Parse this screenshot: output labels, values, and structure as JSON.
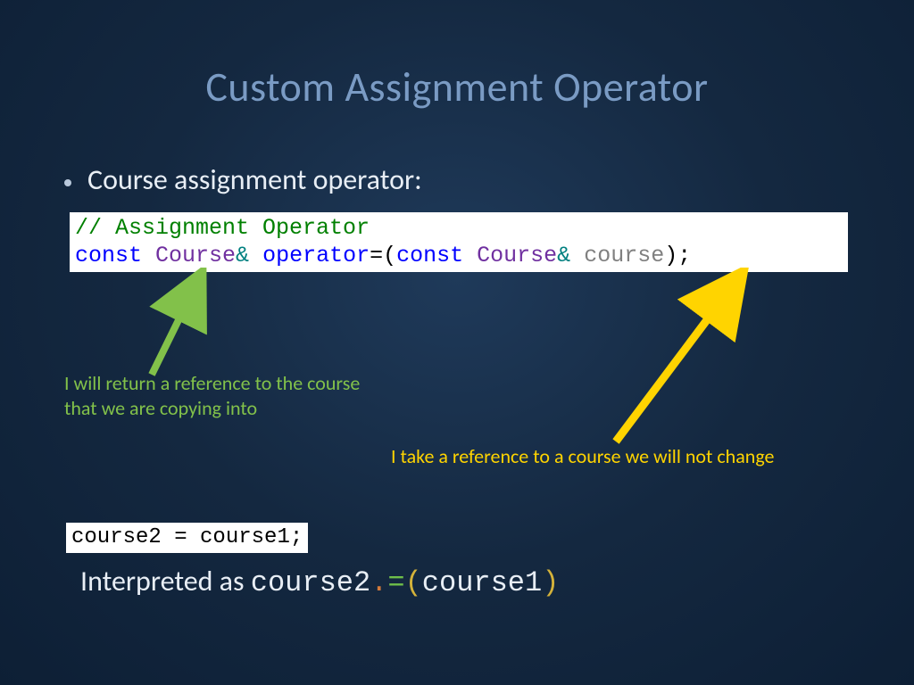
{
  "title": "Custom Assignment Operator",
  "bullet": "Course assignment operator:",
  "code": {
    "comment": "// Assignment Operator",
    "kw_const1": "const",
    "type1": "Course",
    "amp1": "&",
    "op_name": "operator",
    "equals": "=(",
    "kw_const2": "const",
    "type2": "Course",
    "amp2": "&",
    "param": "course",
    "tail": ");"
  },
  "annot_green_l1": "I will return a reference to the course",
  "annot_green_l2": "that we are copying into",
  "annot_yellow": "I take a reference to a course we will not change",
  "code2": {
    "lhs": "course2 ",
    "eq": "=",
    "rhs": " course1",
    "semi": ";"
  },
  "interp": {
    "prefix": "Interpreted as ",
    "part1": "course2",
    "dot": ".",
    "eq": "=",
    "lp": "(",
    "part2": "course1",
    "rp": ")"
  },
  "colors": {
    "arrow_green": "#82c14a",
    "arrow_yellow": "#ffd400"
  }
}
